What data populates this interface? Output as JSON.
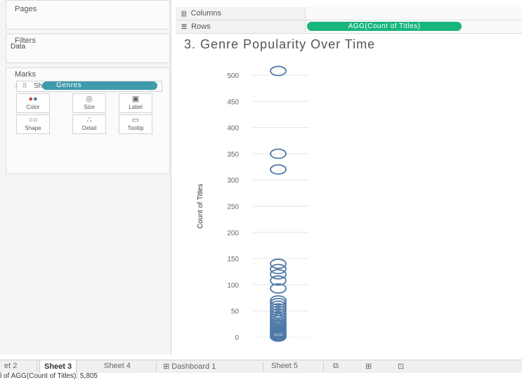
{
  "left_panel": {
    "pages_title": "Pages",
    "filters_title": "Filters",
    "filters_cut_text": "Data",
    "marks_title": "Marks",
    "mark_type": "Shape",
    "mark_buttons": [
      "Color",
      "Size",
      "Label",
      "Shape",
      "Detail",
      "Tooltip"
    ],
    "genres_pill": "Genres"
  },
  "shelves": {
    "columns_label": "Columns",
    "rows_label": "Rows",
    "rows_pill": "AGG(Count of Titles)"
  },
  "chart_data": {
    "type": "scatter",
    "title": "3. Genre Popularity Over Time",
    "ylabel": "Count of Titles",
    "xlabel": "",
    "ylim": [
      0,
      500
    ],
    "yticks": [
      0,
      50,
      100,
      150,
      200,
      250,
      300,
      350,
      400,
      450,
      500
    ],
    "grid": true,
    "marker": "open-circle",
    "marker_color": "#4e79a7",
    "values": [
      508,
      350,
      320,
      140,
      130,
      120,
      108,
      93,
      70,
      65,
      60,
      55,
      50,
      45,
      40,
      36,
      32,
      28,
      25,
      22,
      19,
      16,
      13,
      10,
      8,
      6,
      4,
      2,
      1
    ]
  },
  "tabs": [
    "et 2",
    "Sheet 3",
    "Sheet 4",
    "Dashboard 1",
    "Sheet 5"
  ],
  "active_tab": "Sheet 3",
  "status_text": "l of AGG(Count of Titles): 5,805"
}
